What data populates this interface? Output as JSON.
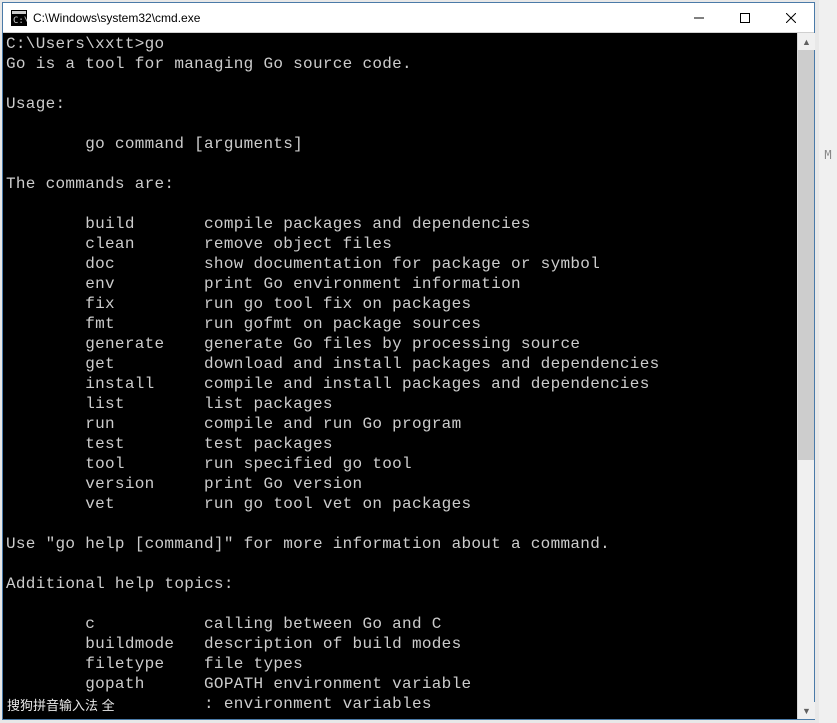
{
  "window": {
    "title": "C:\\Windows\\system32\\cmd.exe"
  },
  "terminal": {
    "prompt": "C:\\Users\\xxtt>",
    "command": "go",
    "intro": "Go is a tool for managing Go source code.",
    "usage_label": "Usage:",
    "usage_line": "        go command [arguments]",
    "commands_label": "The commands are:",
    "commands": [
      {
        "name": "build",
        "desc": "compile packages and dependencies"
      },
      {
        "name": "clean",
        "desc": "remove object files"
      },
      {
        "name": "doc",
        "desc": "show documentation for package or symbol"
      },
      {
        "name": "env",
        "desc": "print Go environment information"
      },
      {
        "name": "fix",
        "desc": "run go tool fix on packages"
      },
      {
        "name": "fmt",
        "desc": "run gofmt on package sources"
      },
      {
        "name": "generate",
        "desc": "generate Go files by processing source"
      },
      {
        "name": "get",
        "desc": "download and install packages and dependencies"
      },
      {
        "name": "install",
        "desc": "compile and install packages and dependencies"
      },
      {
        "name": "list",
        "desc": "list packages"
      },
      {
        "name": "run",
        "desc": "compile and run Go program"
      },
      {
        "name": "test",
        "desc": "test packages"
      },
      {
        "name": "tool",
        "desc": "run specified go tool"
      },
      {
        "name": "version",
        "desc": "print Go version"
      },
      {
        "name": "vet",
        "desc": "run go tool vet on packages"
      }
    ],
    "help_hint": "Use \"go help [command]\" for more information about a command.",
    "topics_label": "Additional help topics:",
    "topics": [
      {
        "name": "c",
        "desc": "calling between Go and C"
      },
      {
        "name": "buildmode",
        "desc": "description of build modes"
      },
      {
        "name": "filetype",
        "desc": "file types"
      },
      {
        "name": "gopath",
        "desc": "GOPATH environment variable"
      }
    ],
    "last_line_tail": ": environment variables"
  },
  "ime": {
    "text": "搜狗拼音输入法 全"
  },
  "edge_letters": {
    "top": "M",
    "bottom": ""
  }
}
